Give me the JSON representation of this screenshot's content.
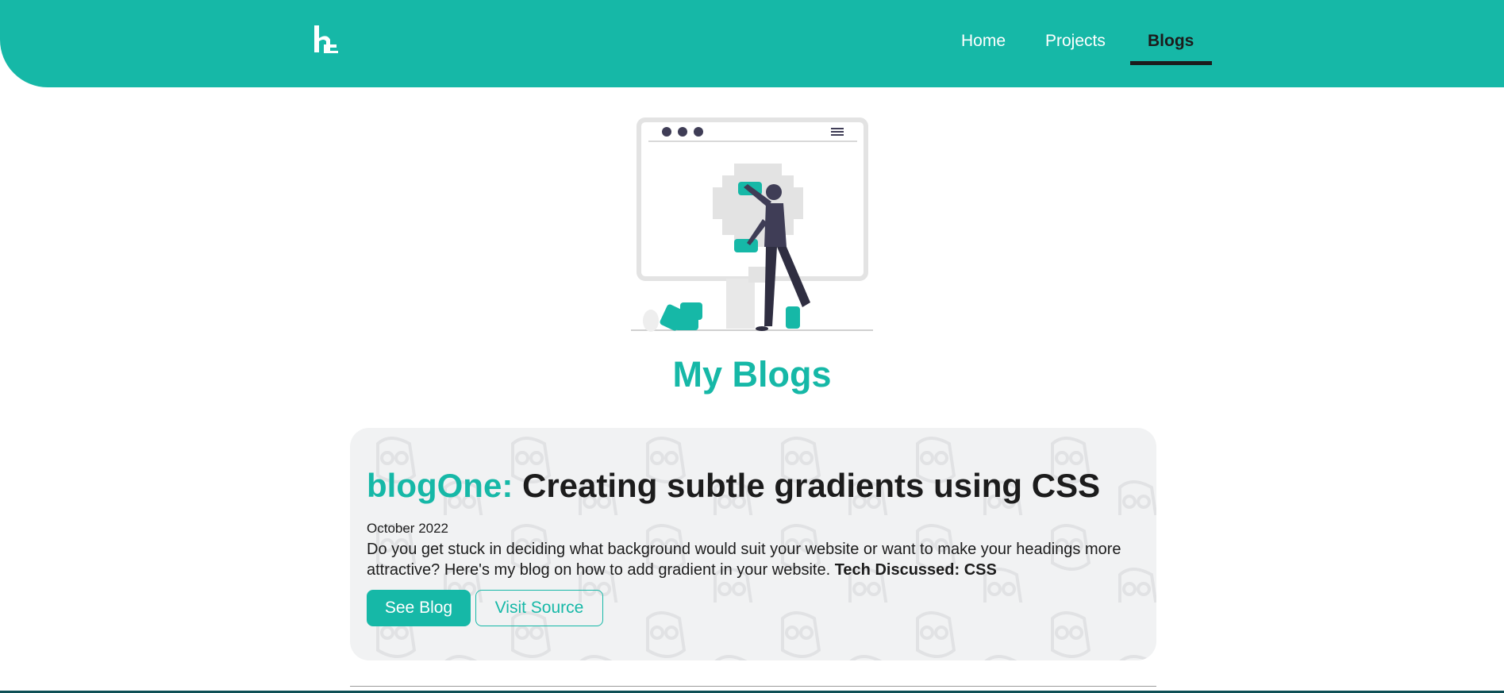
{
  "header": {
    "logo_alt": "h logo",
    "nav": [
      {
        "label": "Home",
        "active": false
      },
      {
        "label": "Projects",
        "active": false
      },
      {
        "label": "Blogs",
        "active": true
      }
    ]
  },
  "hero": {
    "illustration": "person-arranging-blocks-on-screen"
  },
  "page": {
    "title": "My Blogs"
  },
  "blogs": [
    {
      "id_label": "blogOne:",
      "title": "Creating subtle gradients using CSS",
      "date": "October 2022",
      "description": "Do you get stuck in deciding what background would suit your website or want to make your headings more attractive? Here's my blog on how to add gradient in your website.",
      "tech": "Tech Discussed: CSS",
      "primary_button": "See Blog",
      "secondary_button": "Visit Source"
    }
  ],
  "colors": {
    "accent": "#16b8a7",
    "text": "#1c1c1c",
    "card_bg": "#f1f2f3"
  }
}
